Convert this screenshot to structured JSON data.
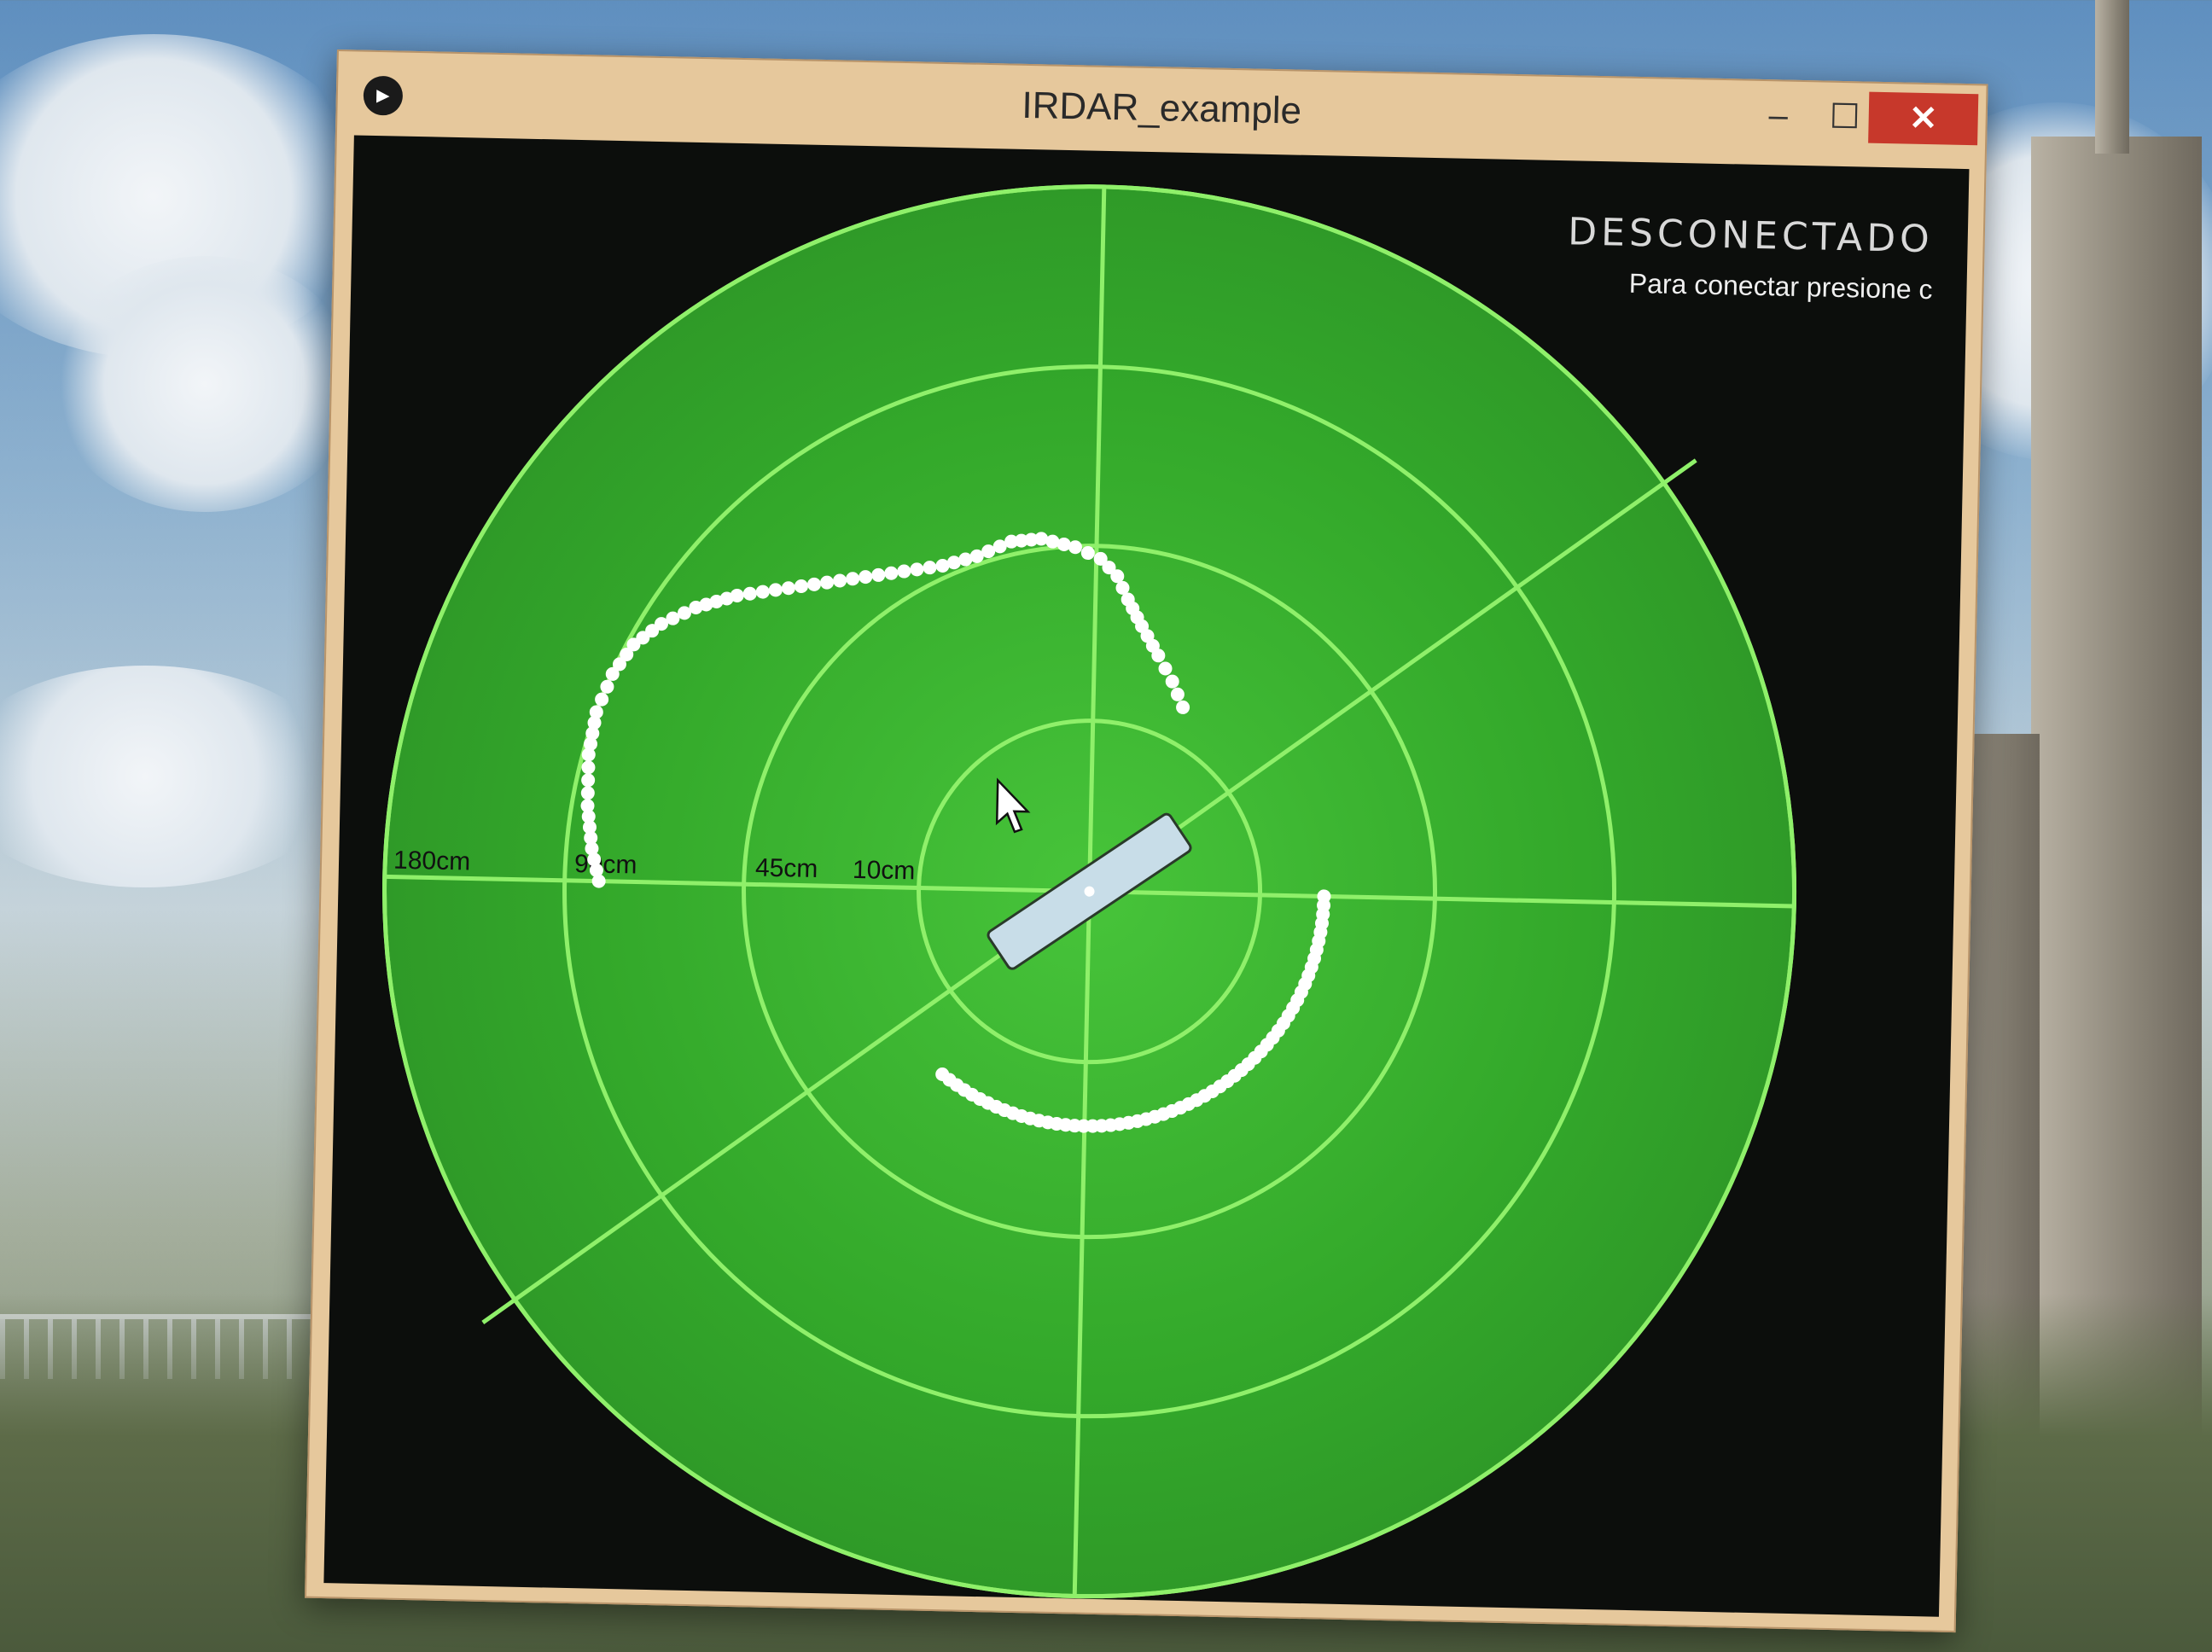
{
  "window": {
    "title": "IRDAR_example",
    "minimize_label": "–",
    "maximize_label": "☐",
    "close_label": "✕",
    "app_icon": "play-icon"
  },
  "status": {
    "title": "DESCONECTADO",
    "hint": "Para conectar presione c"
  },
  "radar": {
    "ring_labels": [
      "180cm",
      "90cm",
      "45cm",
      "10cm"
    ],
    "colors": {
      "background": "#0c0e0c",
      "disc": "#3fb52c",
      "grid": "#8ff06a",
      "points": "#ffffff",
      "robot": "#c8dde8"
    }
  }
}
